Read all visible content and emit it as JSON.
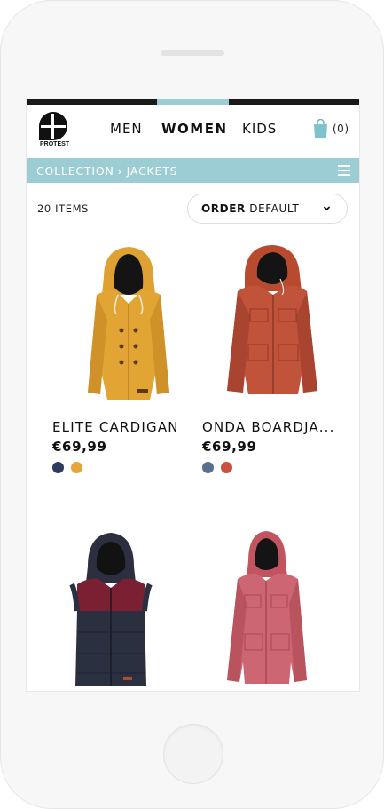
{
  "nav": {
    "brand": "PROTEST",
    "items": [
      {
        "label": "MEN",
        "active": false
      },
      {
        "label": "WOMEN",
        "active": true
      },
      {
        "label": "KIDS",
        "active": false
      }
    ],
    "cart_count": "(0)"
  },
  "breadcrumb": {
    "items": [
      "COLLECTION",
      "JACKETS"
    ],
    "separator": "›"
  },
  "listing": {
    "item_count": "20 ITEMS",
    "sort_label": "ORDER",
    "sort_value": "DEFAULT"
  },
  "products": [
    {
      "name": "ELITE CARDIGAN",
      "price": "€69,99",
      "swatches": [
        "#2d3c5e",
        "#e6a53a"
      ],
      "icon": "hooded-cardigan-image"
    },
    {
      "name": "ONDA BOARDJA...",
      "price": "€69,99",
      "swatches": [
        "#5a6f8c",
        "#c9523e"
      ],
      "icon": "board-jacket-image"
    },
    {
      "name": "",
      "price": "",
      "swatches": [],
      "icon": "puffer-vest-image"
    },
    {
      "name": "",
      "price": "",
      "swatches": [],
      "icon": "parka-jacket-image"
    }
  ],
  "colors": {
    "accent": "#9ccdd4",
    "top_strip": "#1a1a1a"
  }
}
